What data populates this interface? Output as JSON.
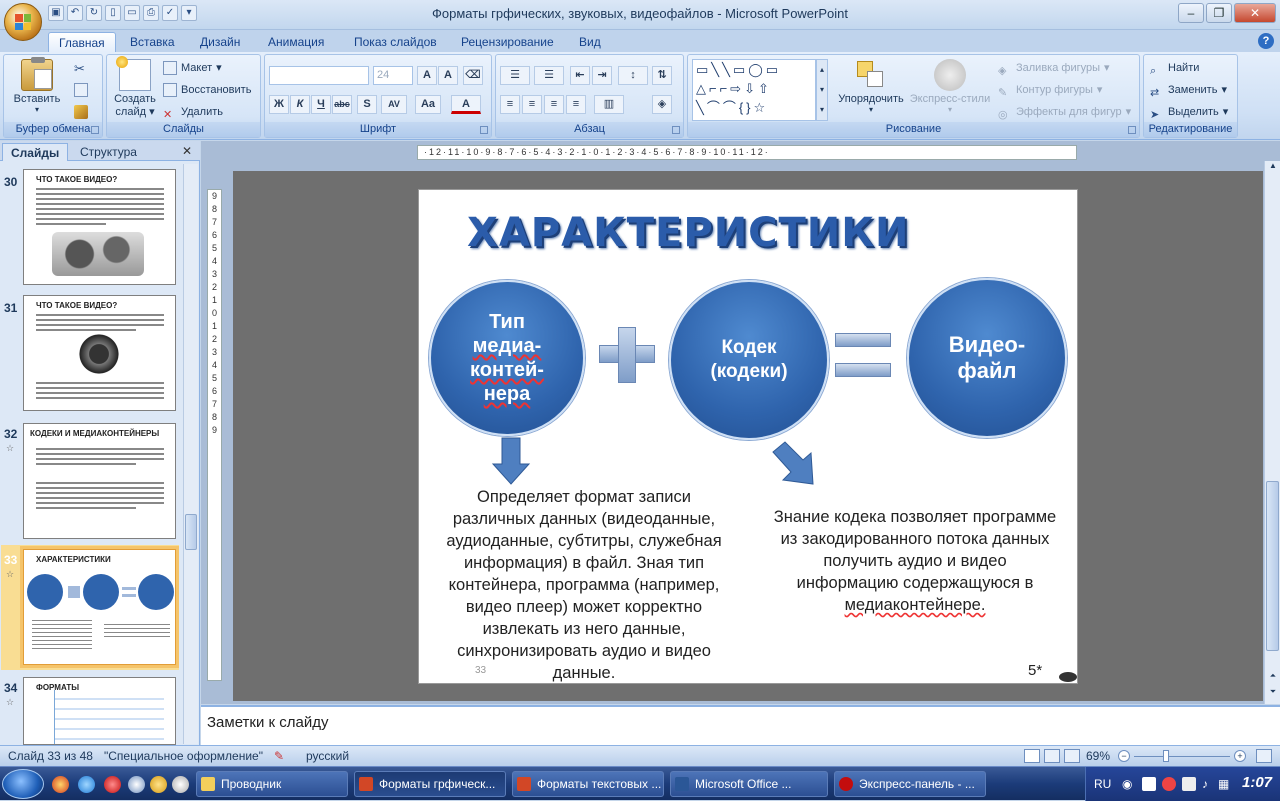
{
  "window": {
    "title": "Форматы грфических, звуковых, видеофайлов - Microsoft PowerPoint"
  },
  "tabs": [
    "Главная",
    "Вставка",
    "Дизайн",
    "Анимация",
    "Показ слайдов",
    "Рецензирование",
    "Вид"
  ],
  "ribbon": {
    "clipboard": {
      "label": "Буфер обмена",
      "paste": "Вставить"
    },
    "slides": {
      "label": "Слайды",
      "create": "Создать",
      "create2": "слайд",
      "layout": "Макет",
      "reset": "Восстановить",
      "delete": "Удалить"
    },
    "font": {
      "label": "Шрифт",
      "size": "24",
      "buttons": [
        "Ж",
        "К",
        "Ч",
        "abc",
        "S",
        "AV",
        "Aa",
        "A"
      ]
    },
    "paragraph": {
      "label": "Абзац"
    },
    "drawing": {
      "label": "Рисование",
      "arrange": "Упорядочить",
      "quickstyles": "Экспресс-стили",
      "fill": "Заливка фигуры",
      "outline": "Контур фигуры",
      "effects": "Эффекты для фигур"
    },
    "editing": {
      "label": "Редактирование",
      "find": "Найти",
      "replace": "Заменить",
      "select": "Выделить"
    }
  },
  "panel": {
    "tab_slides": "Слайды",
    "tab_outline": "Структура",
    "thumbs": [
      {
        "num": "30",
        "title": "ЧТО ТАКОЕ ВИДЕО?"
      },
      {
        "num": "31",
        "title": "ЧТО ТАКОЕ ВИДЕО?"
      },
      {
        "num": "32",
        "title": "КОДЕКИ И МЕДИАКОНТЕЙНЕРЫ"
      },
      {
        "num": "33",
        "title": "ХАРАКТЕРИСТИКИ"
      },
      {
        "num": "34",
        "title": "ФОРМАТЫ"
      }
    ]
  },
  "rulers": {
    "h": "·12·11·10·9·8·7·6·5·4·3·2·1·0·1·2·3·4·5·6·7·8·9·10·11·12·",
    "v": [
      "9",
      "8",
      "7",
      "6",
      "5",
      "4",
      "3",
      "2",
      "1",
      "0",
      "1",
      "2",
      "3",
      "4",
      "5",
      "6",
      "7",
      "8",
      "9"
    ]
  },
  "slide": {
    "title": "ХАРАКТЕРИСТИКИ",
    "circle1": [
      "Тип",
      "медиа-",
      "контей-",
      "нера"
    ],
    "circle2": [
      "Кодек",
      "(кодеки)"
    ],
    "circle3": [
      "Видео-",
      "файл"
    ],
    "para1": [
      "Определяет формат записи",
      "различных данных (видеоданные,",
      "аудиоданные, субтитры, служебная",
      "информация) в файл. Зная тип",
      "контейнера, программа (например,",
      "видео плеер) может корректно",
      "извлекать из него данные,",
      "синхронизировать аудио и видео",
      "данные."
    ],
    "para2": [
      "Знание кодека позволяет программе",
      "из закодированного потока данных",
      "получить аудио и видео",
      "информацию содержащуюся в",
      "медиаконтейнере."
    ],
    "footer_num": "33",
    "corner": "5*"
  },
  "notes": {
    "placeholder": "Заметки к слайду"
  },
  "status": {
    "slide": "Слайд 33 из 48",
    "theme": "\"Специальное оформление\"",
    "lang": "русский",
    "zoom": "69%"
  },
  "taskbar": {
    "items": [
      "Проводник",
      "Форматы грфическ...",
      "Форматы текстовых ...",
      "Microsoft Office ...",
      "Экспресс-панель - ..."
    ],
    "lang": "RU",
    "time": "1:07"
  }
}
